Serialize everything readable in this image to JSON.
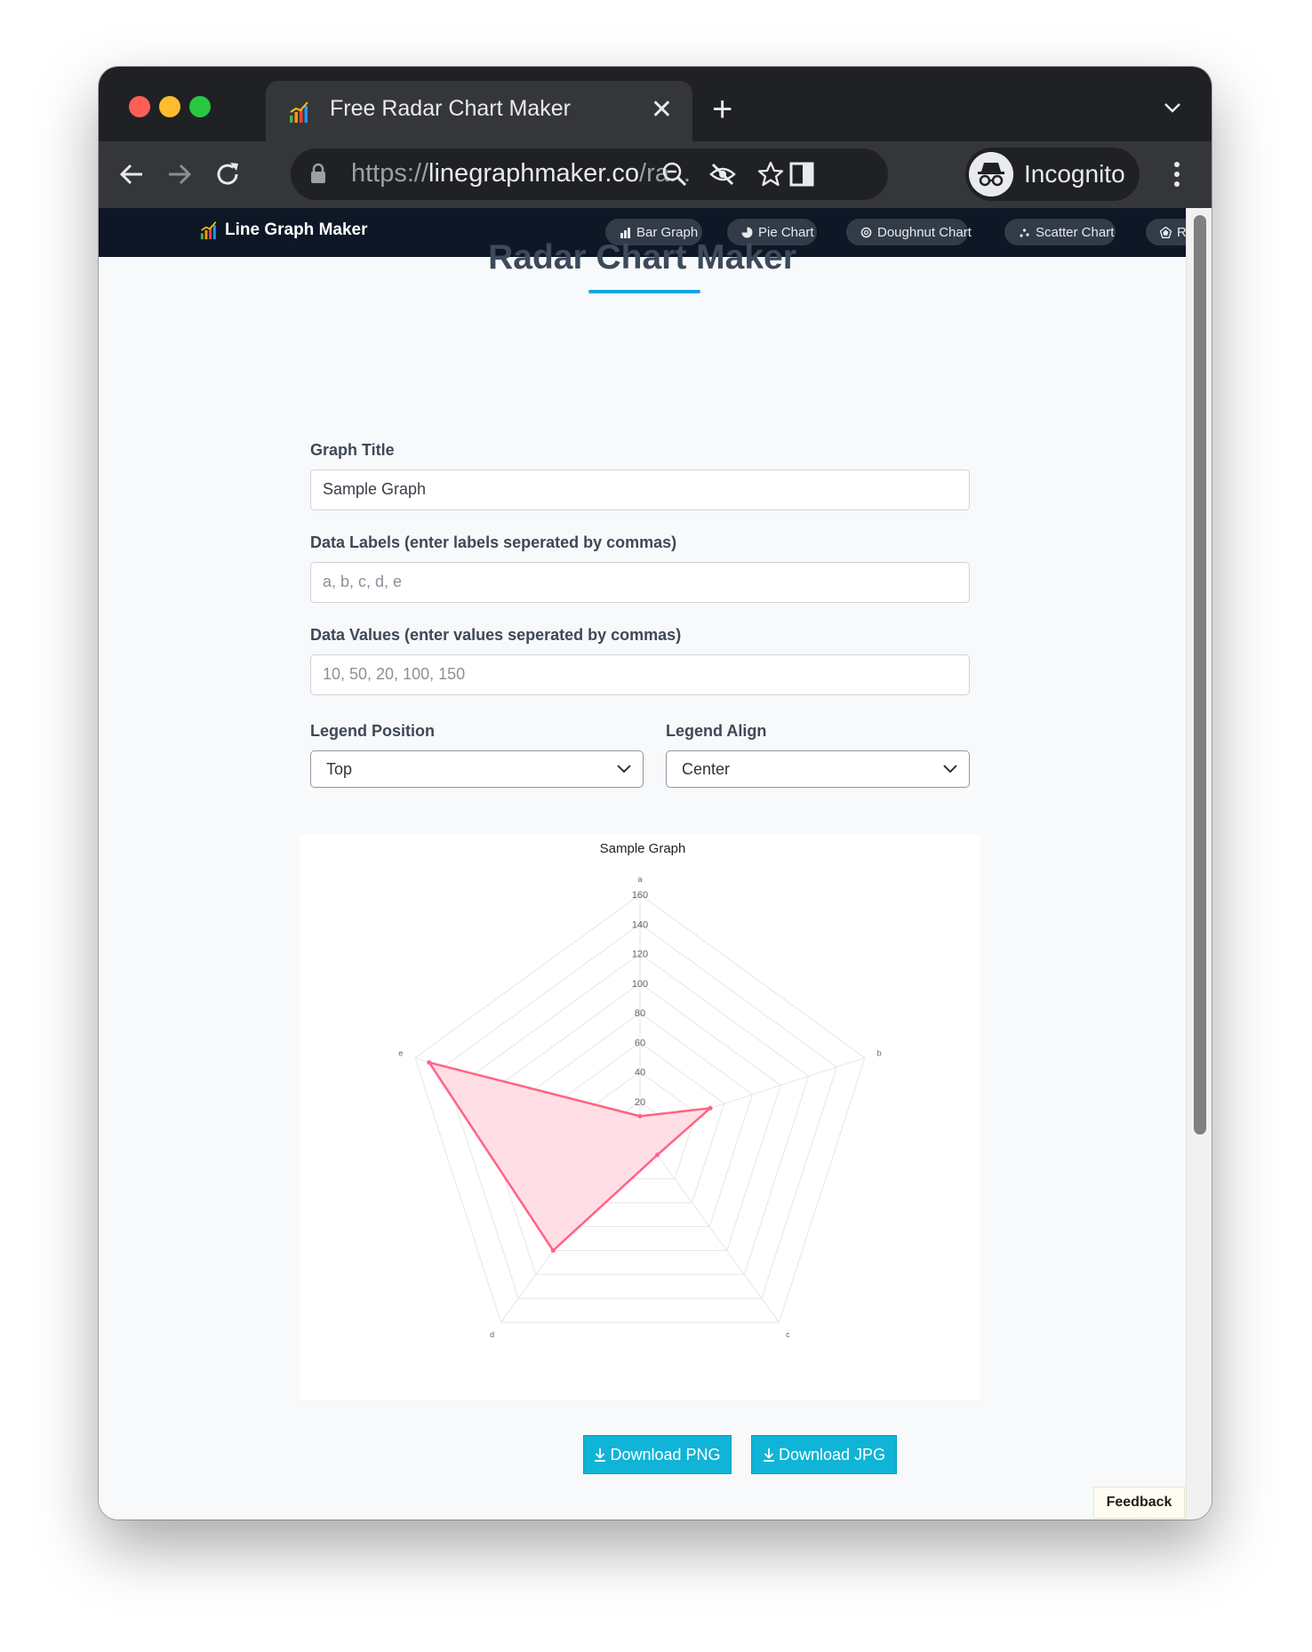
{
  "browser": {
    "tab_title": "Free Radar Chart Maker",
    "url_scheme": "https://",
    "url_host": "linegraphmaker.co",
    "url_rest": "/ra...",
    "profile_label": "Incognito"
  },
  "site": {
    "brand": "Line Graph Maker",
    "nav": [
      {
        "label": "Bar Graph",
        "icon": "bar-chart-icon"
      },
      {
        "label": "Pie Chart",
        "icon": "pie-chart-icon"
      },
      {
        "label": "Doughnut Chart",
        "icon": "doughnut-icon"
      },
      {
        "label": "Scatter Chart",
        "icon": "scatter-icon"
      },
      {
        "label": "Radar Chart",
        "icon": "radar-icon"
      }
    ]
  },
  "page": {
    "title": "Radar Chart Maker",
    "graph_title_label": "Graph Title",
    "graph_title_value": "Sample Graph",
    "labels_label": "Data Labels (enter labels seperated by commas)",
    "labels_placeholder": "a, b, c, d, e",
    "values_label": "Data Values (enter values seperated by commas)",
    "values_placeholder": "10, 50, 20, 100, 150",
    "legend_position_label": "Legend Position",
    "legend_position_value": "Top",
    "legend_align_label": "Legend Align",
    "legend_align_value": "Center",
    "download_png": "Download PNG",
    "download_jpg": "Download JPG",
    "feedback": "Feedback"
  },
  "colors": {
    "accent": "#12a8df",
    "download_button": "#10b4d6",
    "series_line": "#ff6384",
    "series_fill": "#ffd9e1",
    "nav_bg": "#0e1726"
  },
  "chart_data": {
    "type": "radar",
    "title": "Sample Graph",
    "categories": [
      "a",
      "b",
      "c",
      "d",
      "e"
    ],
    "series": [
      {
        "values": [
          10,
          50,
          20,
          100,
          150
        ]
      }
    ],
    "ticks": [
      20,
      40,
      60,
      80,
      100,
      120,
      140,
      160
    ],
    "rlim": [
      0,
      160
    ],
    "grid": true
  }
}
